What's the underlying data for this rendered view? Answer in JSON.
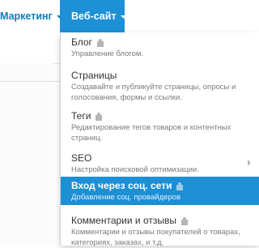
{
  "nav": {
    "marketing_label": "Маркетинг",
    "website_label": "Веб-сайт"
  },
  "menu": {
    "items": [
      {
        "title": "Блог",
        "description": "Управление блогом.",
        "has_plugin_icon": true
      },
      {
        "title": "Страницы",
        "description": "Создавайте и публикуйте страницы, опросы и голосования, формы и ссылки.",
        "has_plugin_icon": false
      },
      {
        "title": "Теги",
        "description": "Редактирование тегов товаров и контентных страниц.",
        "has_plugin_icon": true
      },
      {
        "title": "SEO",
        "description": "Настройка поисковой оптимизации.",
        "has_plugin_icon": false,
        "has_submenu": true
      },
      {
        "title": "Вход через соц. сети",
        "description": "Добавление соц. провайдеров",
        "has_plugin_icon": true,
        "active": true
      },
      {
        "title": "Комментарии и отзывы",
        "description": "Комментарии и отзывы покупателей о товарах, категориях, заказах, и т.д.",
        "has_plugin_icon": true
      }
    ]
  },
  "colors": {
    "accent": "#1e90d6",
    "nav_text": "#0b7dbb",
    "active_item_bg": "#1e8fd5"
  },
  "icons": {
    "caret": "chevron-down-icon",
    "plugin": "puzzle-icon",
    "submenu": "chevron-right-icon"
  }
}
